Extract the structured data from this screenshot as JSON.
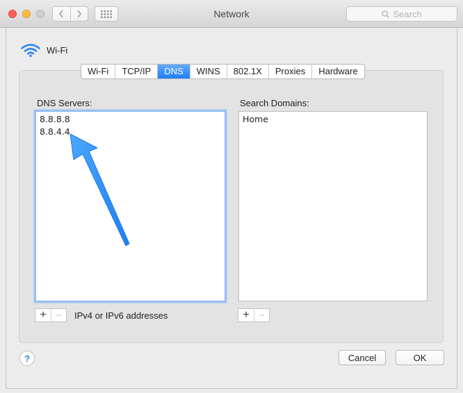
{
  "window": {
    "title": "Network"
  },
  "search": {
    "placeholder": "Search"
  },
  "header": {
    "interface_label": "Wi-Fi"
  },
  "tabs": [
    {
      "label": "Wi-Fi",
      "active": false
    },
    {
      "label": "TCP/IP",
      "active": false
    },
    {
      "label": "DNS",
      "active": true
    },
    {
      "label": "WINS",
      "active": false
    },
    {
      "label": "802.1X",
      "active": false
    },
    {
      "label": "Proxies",
      "active": false
    },
    {
      "label": "Hardware",
      "active": false
    }
  ],
  "dns": {
    "label": "DNS Servers:",
    "servers": [
      "8.8.8.8",
      "8.8.4.4"
    ],
    "hint": "IPv4 or IPv6 addresses"
  },
  "search_domains": {
    "label": "Search Domains:",
    "items": [
      "Home"
    ]
  },
  "buttons": {
    "add": "+",
    "remove": "−",
    "help": "?",
    "cancel": "Cancel",
    "ok": "OK"
  },
  "colors": {
    "accent": "#1f7ff7",
    "annotation_arrow": "#2a8cf5",
    "close": "#fc605c",
    "minimize": "#fdbc40"
  },
  "icons": [
    "wifi-icon",
    "magnifier-icon",
    "chevron-left-icon",
    "chevron-right-icon",
    "grid-icon",
    "annotation-arrow"
  ]
}
